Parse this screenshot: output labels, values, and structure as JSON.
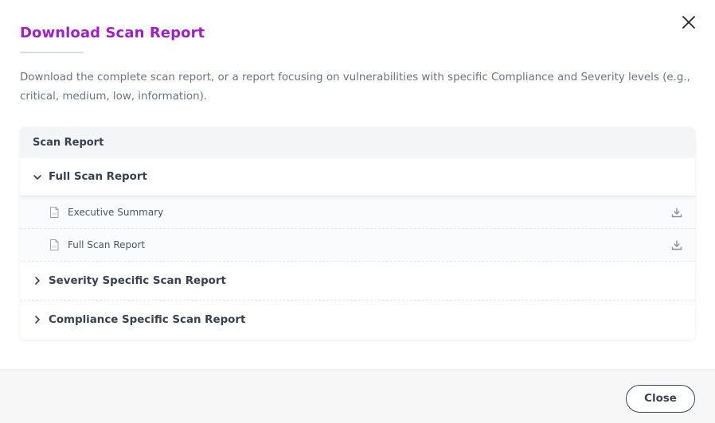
{
  "dialog": {
    "title": "Download Scan Report",
    "description": "Download the complete scan report, or a report focusing on vulnerabilities with specific Compliance and Severity levels (e.g., critical, medium, low, information)."
  },
  "table": {
    "header": "Scan Report",
    "groups": [
      {
        "label": "Full Scan Report",
        "expanded": true,
        "items": [
          {
            "label": "Executive Summary",
            "icon": "pdf-file-icon",
            "action_icon": "download-icon"
          },
          {
            "label": "Full Scan Report",
            "icon": "pdf-file-icon",
            "action_icon": "download-icon"
          }
        ]
      },
      {
        "label": "Severity Specific Scan Report",
        "expanded": false
      },
      {
        "label": "Compliance Specific Scan Report",
        "expanded": false
      }
    ]
  },
  "footer": {
    "close_label": "Close"
  },
  "colors": {
    "title": "#a020c8",
    "text": "#3b4252",
    "muted_text": "#6b7280",
    "header_bg": "#f4f5f7",
    "footer_bg": "#f7f7f8"
  }
}
